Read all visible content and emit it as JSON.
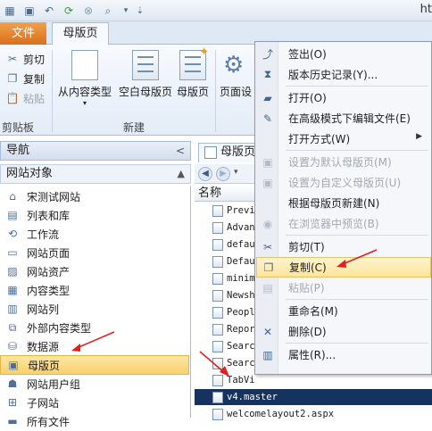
{
  "window": {
    "title_fragment": "ht"
  },
  "quick_access": {
    "icons": [
      "app-icon",
      "save-icon",
      "undo-icon",
      "refresh-icon",
      "stop-icon",
      "preview-icon",
      "customize-icon"
    ]
  },
  "ribbon": {
    "tabs": {
      "file": "文件",
      "master_page": "母版页"
    },
    "clipboard": {
      "cut": "剪切",
      "copy": "复制",
      "paste": "粘贴",
      "label": "剪贴板"
    },
    "new_group": {
      "from_content_type": "从内容类型",
      "blank_master": "空白母版页",
      "master": "母版页",
      "page_layout_fragment": "页面设",
      "label": "新建"
    }
  },
  "nav": {
    "title": "导航",
    "collapse_glyph": "<",
    "section": "网站对象",
    "items": [
      {
        "label": "宋测试网站",
        "icon": "home-icon"
      },
      {
        "label": "列表和库",
        "icon": "list-icon"
      },
      {
        "label": "工作流",
        "icon": "workflow-icon"
      },
      {
        "label": "网站页面",
        "icon": "page-icon"
      },
      {
        "label": "网站资产",
        "icon": "asset-icon"
      },
      {
        "label": "内容类型",
        "icon": "content-type-icon"
      },
      {
        "label": "网站列",
        "icon": "column-icon"
      },
      {
        "label": "外部内容类型",
        "icon": "external-content-icon"
      },
      {
        "label": "数据源",
        "icon": "database-icon"
      },
      {
        "label": "母版页",
        "icon": "master-page-icon"
      },
      {
        "label": "网站用户组",
        "icon": "group-icon"
      },
      {
        "label": "子网站",
        "icon": "subsite-icon"
      },
      {
        "label": "所有文件",
        "icon": "folder-icon"
      }
    ]
  },
  "main": {
    "tab_label": "母版页",
    "column_name": "名称",
    "files": [
      "Previ",
      "Advan",
      "defau",
      "Defau",
      "minim",
      "Newsh",
      "People",
      "Repor",
      "Searc",
      "Searc",
      "TabVi",
      "v4.master",
      "welcomelayout2.aspx"
    ],
    "selected_file": "v4.master"
  },
  "context_menu": {
    "items": [
      {
        "label": "签出(O)",
        "icon": "checkout-icon",
        "disabled": false
      },
      {
        "label": "版本历史记录(Y)...",
        "icon": "history-icon",
        "disabled": false
      },
      {
        "label": "打开(O)",
        "icon": "open-icon",
        "disabled": false
      },
      {
        "label": "在高级模式下编辑文件(E)",
        "icon": "edit-advanced-icon",
        "disabled": false
      },
      {
        "label": "打开方式(W)",
        "icon": "",
        "disabled": false,
        "submenu": true
      },
      {
        "label": "设置为默认母版页(M)",
        "icon": "default-master-icon",
        "disabled": true
      },
      {
        "label": "设置为自定义母版页(U)",
        "icon": "custom-master-icon",
        "disabled": true
      },
      {
        "label": "根据母版页新建(N)",
        "icon": "",
        "disabled": false
      },
      {
        "label": "在浏览器中预览(B)",
        "icon": "browser-preview-icon",
        "disabled": true
      },
      {
        "label": "剪切(T)",
        "icon": "cut-icon",
        "disabled": false
      },
      {
        "label": "复制(C)",
        "icon": "copy-icon",
        "disabled": false,
        "highlight": true
      },
      {
        "label": "粘贴(P)",
        "icon": "paste-icon",
        "disabled": true
      },
      {
        "label": "重命名(M)",
        "icon": "rename-icon",
        "disabled": false
      },
      {
        "label": "删除(D)",
        "icon": "delete-icon",
        "disabled": false
      },
      {
        "label": "属性(R)...",
        "icon": "properties-icon",
        "disabled": false
      }
    ]
  },
  "colors": {
    "accent_orange": "#d9701c",
    "selection_yellow": "#f9d06d",
    "annotation_red": "#e0201c",
    "selected_row": "#16325e"
  }
}
